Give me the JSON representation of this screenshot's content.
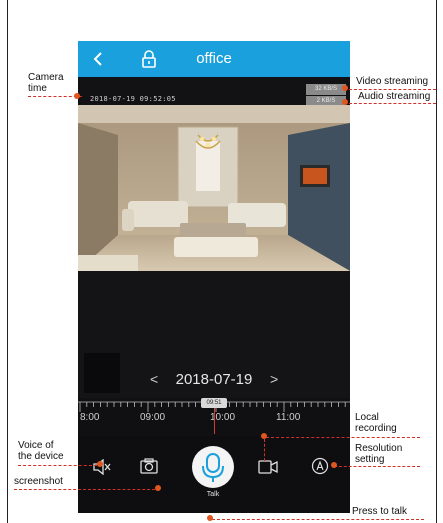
{
  "app": {
    "title": "office",
    "camera_time": "2018-07-19 09:52:05",
    "video_rate": "32 KB/S",
    "audio_rate": "2 KB/S"
  },
  "playback": {
    "date": "2018-07-19",
    "prev_symbol": "<",
    "next_symbol": ">",
    "ticks": [
      "8:00",
      "09:00",
      "10:00",
      "11:00"
    ],
    "current_time": "09:51"
  },
  "controls": {
    "talk_label": "Talk"
  },
  "annotations": {
    "camera_time": "Camera\ntime",
    "video_streaming": "Video streaming",
    "audio_streaming": "Audio streaming",
    "local_recording": "Local\nrecording",
    "voice": "Voice of\nthe device",
    "resolution": "Resolution\nsetting",
    "screenshot": "screenshot",
    "press_to_talk": "Press to talk"
  },
  "colors": {
    "header": "#1aa0dc",
    "annotation_line": "#d0302a",
    "annotation_dot": "#e0561e"
  }
}
